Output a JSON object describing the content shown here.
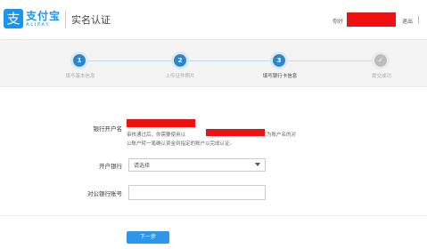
{
  "header": {
    "logo_glyph": "支",
    "logo_name": "支付宝",
    "logo_sub": "ALIPAY",
    "page_title": "实名认证",
    "greeting": "你好",
    "exit_label": "退出"
  },
  "steps": [
    {
      "number": "1",
      "label": "填写基本信息"
    },
    {
      "number": "2",
      "label": "上传证件照片"
    },
    {
      "number": "3",
      "label": "填写银行卡信息"
    },
    {
      "number": "✓",
      "label": "提交成功"
    }
  ],
  "form": {
    "account_name_label": "银行开户名",
    "help_line1_a": "审核通过后，你需要使用以",
    "help_line1_b": "为账户名的对",
    "help_line2": "公账户转一笔确认资金到指定的账户以完成认证。",
    "bank_label": "开户银行",
    "bank_value": "请选择",
    "account_number_label": "对公银行账号",
    "account_number_value": "",
    "next_label": "下一步"
  },
  "colors": {
    "brand": "#1a95ee",
    "step_active": "#2f87c8",
    "step_done": "#bcbcbc",
    "primary_button": "#2d96e6",
    "redaction": "#ee1111"
  }
}
